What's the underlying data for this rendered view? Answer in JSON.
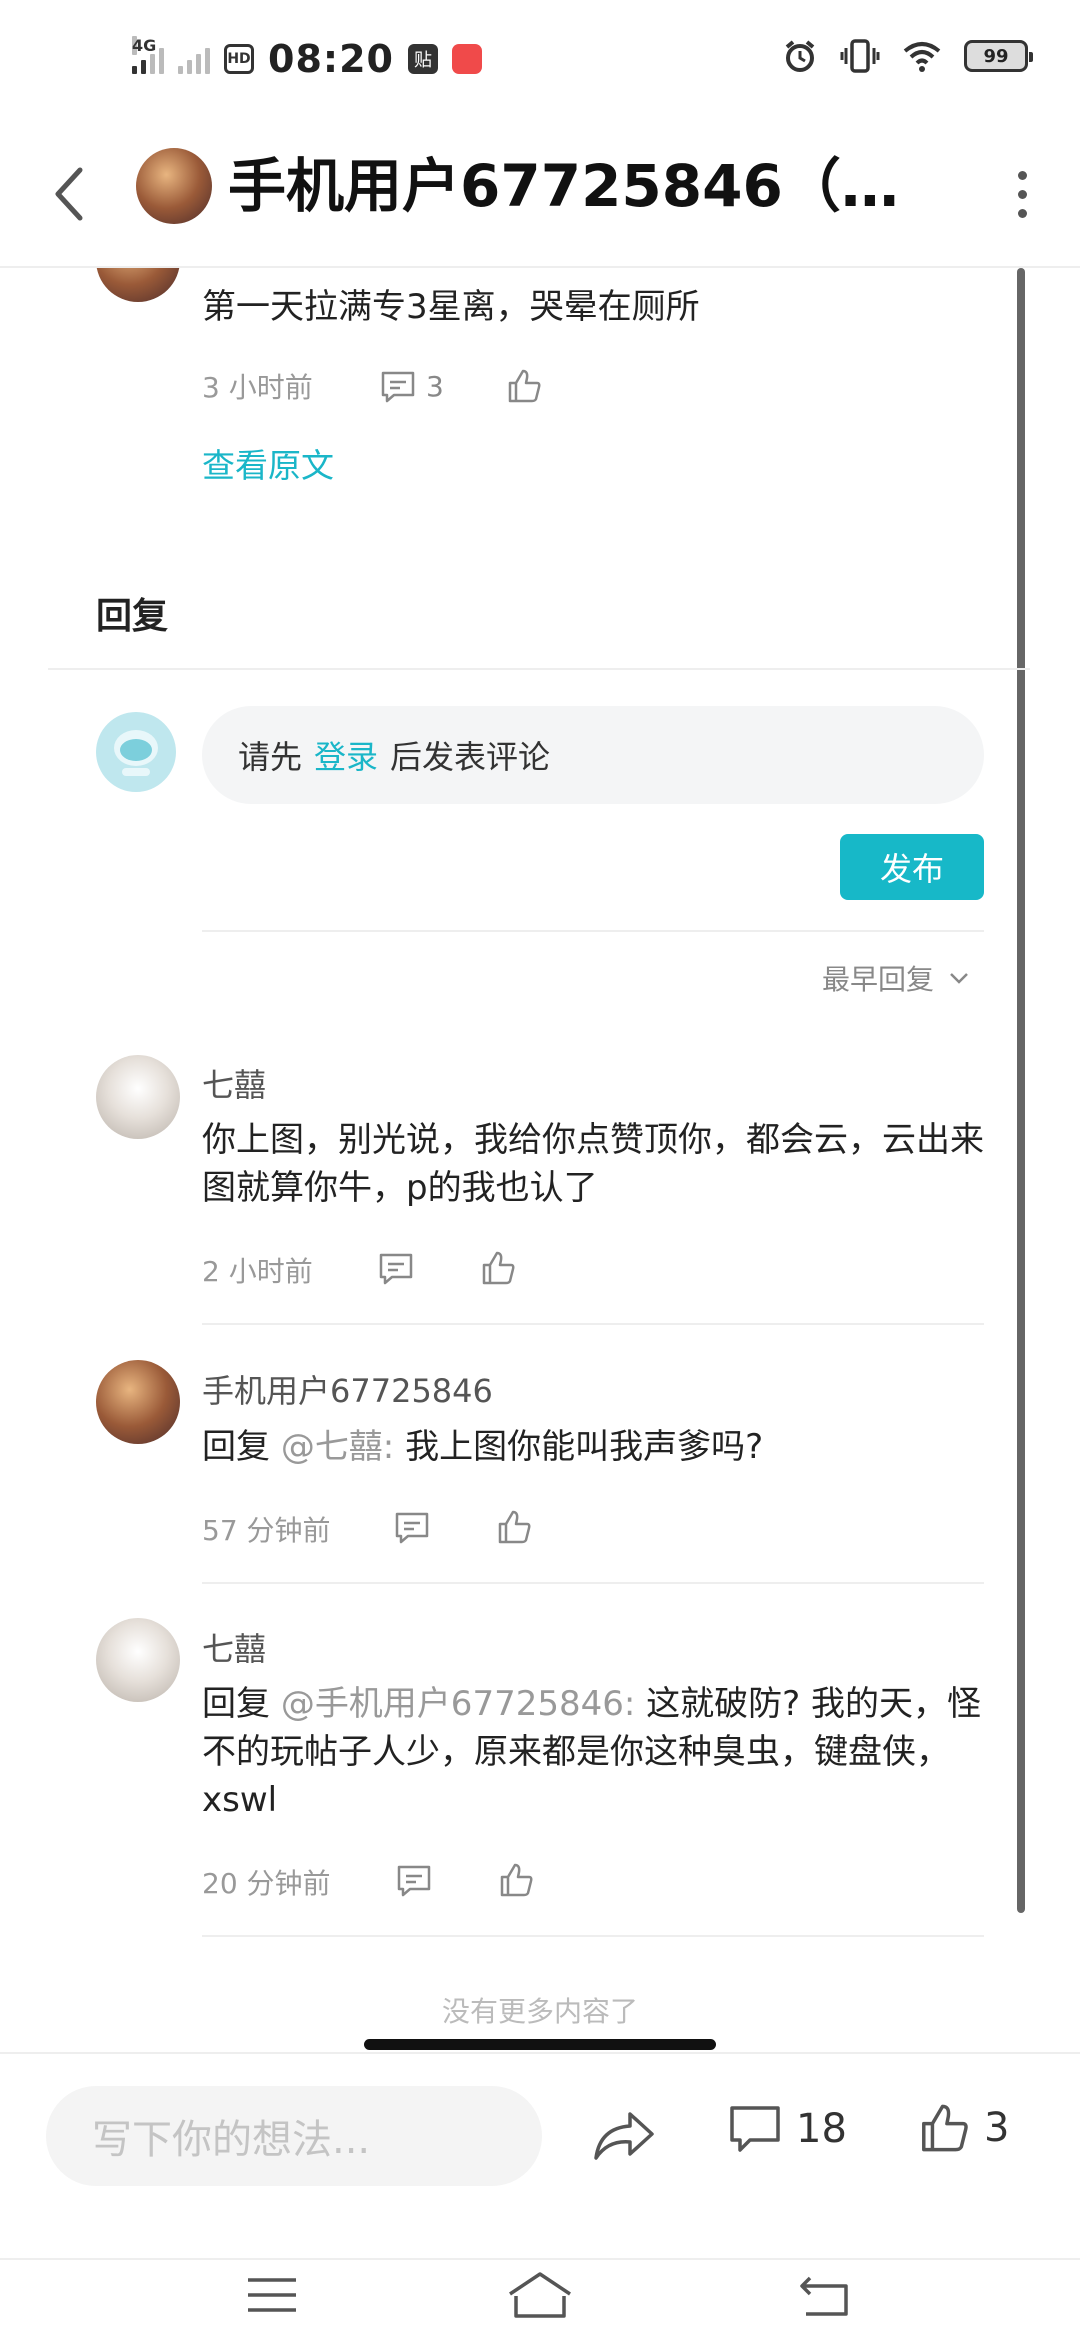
{
  "status_bar": {
    "network": "4G",
    "hd": "HD",
    "time": "08:20",
    "tie_label": "贴",
    "battery": "99",
    "icons": [
      "alarm-icon",
      "vibrate-icon",
      "wifi-icon"
    ]
  },
  "header": {
    "title": "手机用户67725846（…"
  },
  "post": {
    "text": "第一天拉满专3星离，哭晕在厕所",
    "time": "3 小时前",
    "comment_count": "3",
    "view_original": "查看原文"
  },
  "reply_section": {
    "heading": "回复",
    "prompt_prefix": "请先",
    "login_link": "登录",
    "prompt_suffix": "后发表评论",
    "publish": "发布",
    "sort_label": "最早回复"
  },
  "comments": [
    {
      "name": "七囍",
      "line1": "你上图，别光说，我给你点赞顶你，都会云，云出来",
      "line2": "图就算你牛，p的我也认了",
      "time": "2 小时前"
    },
    {
      "name": "手机用户67725846",
      "reply_prefix": "回复",
      "quote": "@七囍:",
      "text": "我上图你能叫我声爹吗?",
      "time": "57 分钟前"
    },
    {
      "name": "七囍",
      "reply_prefix": "回复",
      "quote": "@手机用户67725846:",
      "text1": "这就破防? 我的天，怪",
      "line2": "不的玩帖子人少，原来都是你这种臭虫，键盘侠，",
      "line3": "xswl",
      "time": "20 分钟前"
    }
  ],
  "footer": {
    "no_more": "没有更多内容了",
    "input_placeholder": "写下你的想法...",
    "comment_total": "18",
    "like_total": "3"
  },
  "colors": {
    "accent": "#17b8c8",
    "link": "#1ab6c8"
  }
}
